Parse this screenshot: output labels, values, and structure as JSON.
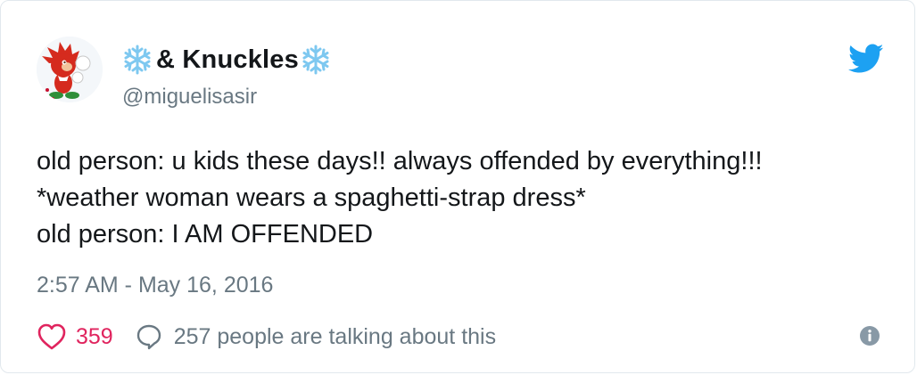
{
  "tweet": {
    "display_name": "& Knuckles",
    "handle": "@miguelisasir",
    "lines": [
      "old person: u kids these days!! always offended by everything!!!",
      "*weather woman wears a spaghetti-strap dress*",
      "old person: I AM OFFENDED"
    ],
    "timestamp": "2:57 AM - May 16, 2016",
    "likes": "359",
    "replies_text": "257 people are talking about this"
  },
  "icons": {
    "avatar": "avatar-knuckles",
    "name_prefix": "snowflake-icon",
    "name_suffix": "snowflake-icon",
    "brand": "twitter-bird-icon",
    "like": "heart-icon",
    "reply": "speech-bubble-icon",
    "info": "info-icon"
  },
  "colors": {
    "text": "#14171a",
    "secondary": "#697882",
    "like": "#e0245e",
    "twitter_blue": "#1da1f2",
    "snowflake": "#7ec8f0",
    "border": "#e1e8ed"
  }
}
